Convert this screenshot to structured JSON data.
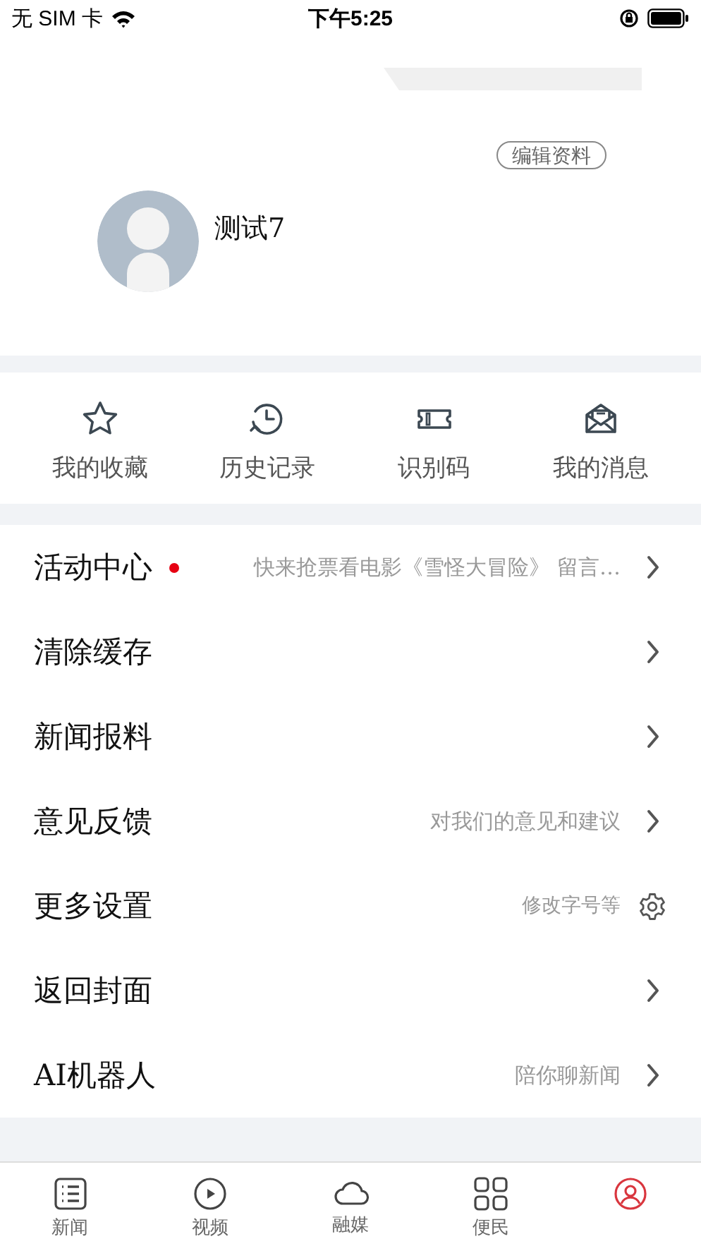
{
  "status_bar": {
    "carrier": "无 SIM 卡",
    "time": "下午5:25"
  },
  "profile": {
    "edit_button": "编辑资料",
    "username": "测试7"
  },
  "quick_actions": [
    {
      "label": "我的收藏"
    },
    {
      "label": "历史记录"
    },
    {
      "label": "识别码"
    },
    {
      "label": "我的消息"
    }
  ],
  "menu": [
    {
      "kind": "link",
      "title": "活动中心",
      "unread": true,
      "detail": "快来抢票看电影《雪怪大冒险》 留言…"
    },
    {
      "kind": "link",
      "title": "清除缓存",
      "unread": false
    },
    {
      "kind": "link",
      "title": "新闻报料",
      "unread": false
    },
    {
      "kind": "link",
      "title": "意见反馈",
      "unread": false,
      "detail": "对我们的意见和建议"
    },
    {
      "kind": "settings",
      "title": "更多设置",
      "unread": false,
      "detail": "修改字号等"
    },
    {
      "kind": "link",
      "title": "返回封面",
      "unread": false
    },
    {
      "kind": "link",
      "title": "AI机器人",
      "unread": false,
      "detail": "陪你聊新闻"
    }
  ],
  "tab_bar": [
    {
      "label": "新闻",
      "selected": false
    },
    {
      "label": "视频",
      "selected": false
    },
    {
      "label": "融媒",
      "selected": false
    },
    {
      "label": "便民",
      "selected": false
    },
    {
      "selected": true
    }
  ]
}
